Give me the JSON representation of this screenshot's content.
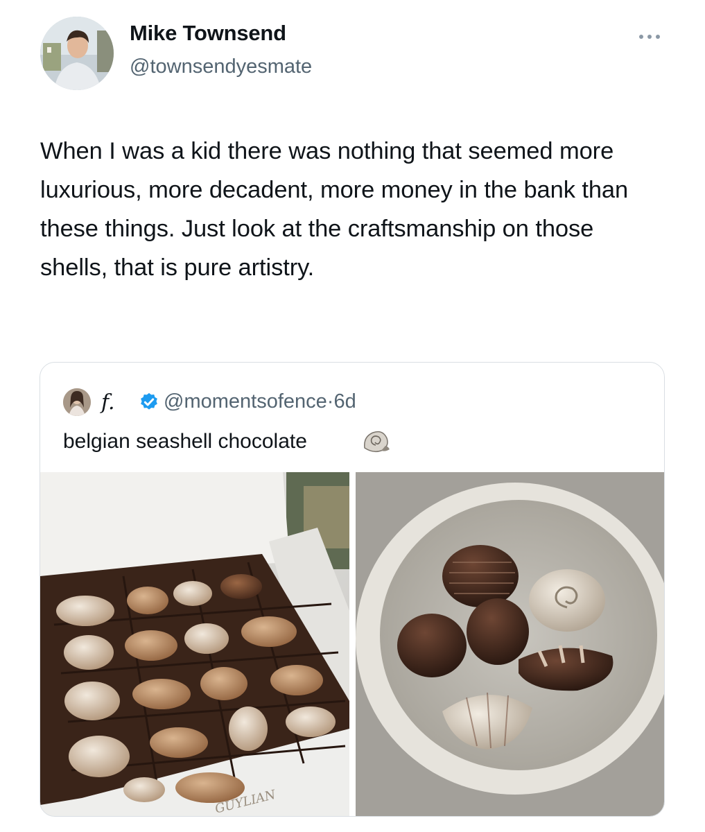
{
  "tweet": {
    "author_name": "Mike Townsend",
    "author_handle": "@townsendyesmate",
    "more_icon": "more-horizontal-icon",
    "text": "When I was a kid there was nothing that seemed more luxurious, more decadent, more money in the bank than these things. Just look at the craftsmanship on those shells, that is pure artistry."
  },
  "quoted_tweet": {
    "author_name": "f.",
    "verified_icon": "verified-badge-icon",
    "author_handle": "@momentsofence",
    "separator": "·",
    "age": "6d",
    "text": "belgian seashell chocolate",
    "emoji_icon": "spiral-shell-emoji",
    "images": [
      {
        "brand_text": "GUYLIAN"
      },
      {}
    ]
  },
  "colors": {
    "text_primary": "#0f1419",
    "text_secondary": "#536471",
    "border": "#d9dee3",
    "verified": "#1d9bf0"
  }
}
